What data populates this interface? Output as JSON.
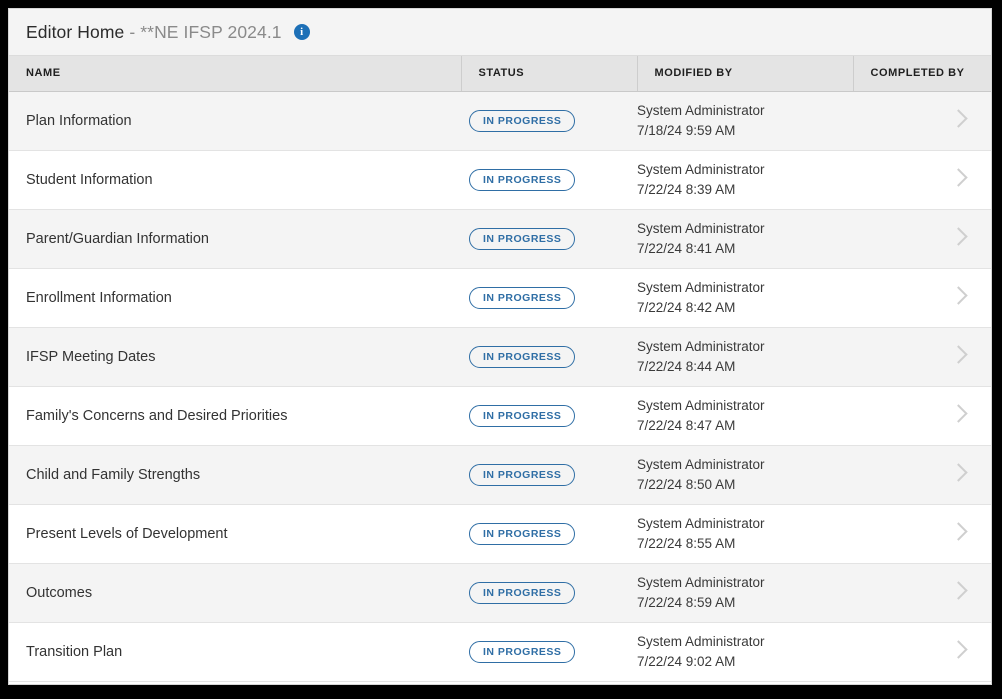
{
  "header": {
    "title_main": "Editor Home",
    "title_sub": "- **NE IFSP 2024.1",
    "info_icon_label": "i",
    "bg_color": "#f4f4f4"
  },
  "table": {
    "columns": [
      {
        "key": "name",
        "label": "NAME"
      },
      {
        "key": "status",
        "label": "STATUS"
      },
      {
        "key": "modified_by",
        "label": "MODIFIED BY"
      },
      {
        "key": "completed_by",
        "label": "COMPLETED BY"
      }
    ],
    "accent_color": "#2f6ea5",
    "header_bg": "#e4e4e4",
    "row_alt_bg": "#f4f4f4",
    "rows": [
      {
        "name": "Plan Information",
        "status": "IN PROGRESS",
        "modified_user": "System Administrator",
        "modified_date": "7/18/24 9:59 AM",
        "completed_by": ""
      },
      {
        "name": "Student Information",
        "status": "IN PROGRESS",
        "modified_user": "System Administrator",
        "modified_date": "7/22/24 8:39 AM",
        "completed_by": ""
      },
      {
        "name": "Parent/Guardian Information",
        "status": "IN PROGRESS",
        "modified_user": "System Administrator",
        "modified_date": "7/22/24 8:41 AM",
        "completed_by": ""
      },
      {
        "name": "Enrollment Information",
        "status": "IN PROGRESS",
        "modified_user": "System Administrator",
        "modified_date": "7/22/24 8:42 AM",
        "completed_by": ""
      },
      {
        "name": "IFSP Meeting Dates",
        "status": "IN PROGRESS",
        "modified_user": "System Administrator",
        "modified_date": "7/22/24 8:44 AM",
        "completed_by": ""
      },
      {
        "name": "Family's Concerns and Desired Priorities",
        "status": "IN PROGRESS",
        "modified_user": "System Administrator",
        "modified_date": "7/22/24 8:47 AM",
        "completed_by": ""
      },
      {
        "name": "Child and Family Strengths",
        "status": "IN PROGRESS",
        "modified_user": "System Administrator",
        "modified_date": "7/22/24 8:50 AM",
        "completed_by": ""
      },
      {
        "name": "Present Levels of Development",
        "status": "IN PROGRESS",
        "modified_user": "System Administrator",
        "modified_date": "7/22/24 8:55 AM",
        "completed_by": ""
      },
      {
        "name": "Outcomes",
        "status": "IN PROGRESS",
        "modified_user": "System Administrator",
        "modified_date": "7/22/24 8:59 AM",
        "completed_by": ""
      },
      {
        "name": "Transition Plan",
        "status": "IN PROGRESS",
        "modified_user": "System Administrator",
        "modified_date": "7/22/24 9:02 AM",
        "completed_by": ""
      }
    ]
  }
}
